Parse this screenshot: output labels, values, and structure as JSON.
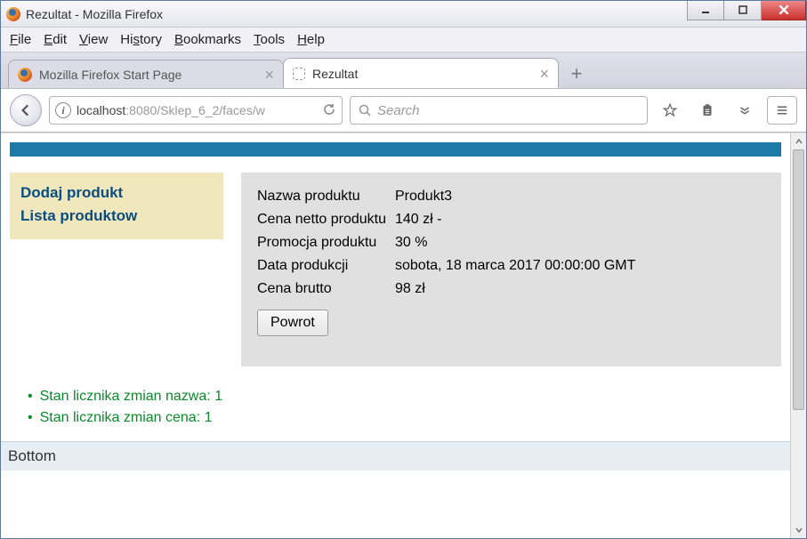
{
  "window": {
    "title": "Rezultat - Mozilla Firefox"
  },
  "menubar": [
    "File",
    "Edit",
    "View",
    "History",
    "Bookmarks",
    "Tools",
    "Help"
  ],
  "tabs": [
    {
      "label": "Mozilla Firefox Start Page",
      "active": false
    },
    {
      "label": "Rezultat",
      "active": true
    }
  ],
  "address": {
    "host": "localhost",
    "rest": ":8080/Sklep_6_2/faces/w"
  },
  "search": {
    "placeholder": "Search"
  },
  "sidebar": {
    "links": [
      "Dodaj produkt",
      "Lista produktow"
    ]
  },
  "details": {
    "rows": [
      {
        "label": "Nazwa produktu",
        "value": "Produkt3"
      },
      {
        "label": "Cena netto produktu",
        "value": "140 zł -"
      },
      {
        "label": "Promocja produktu",
        "value": "30 %"
      },
      {
        "label": "Data produkcji",
        "value": "sobota, 18 marca 2017 00:00:00 GMT"
      },
      {
        "label": "Cena brutto",
        "value": "98 zł"
      }
    ],
    "back_label": "Powrot"
  },
  "messages": [
    "Stan licznika zmian nazwa: 1",
    "Stan licznika zmian cena: 1"
  ],
  "footer": "Bottom"
}
